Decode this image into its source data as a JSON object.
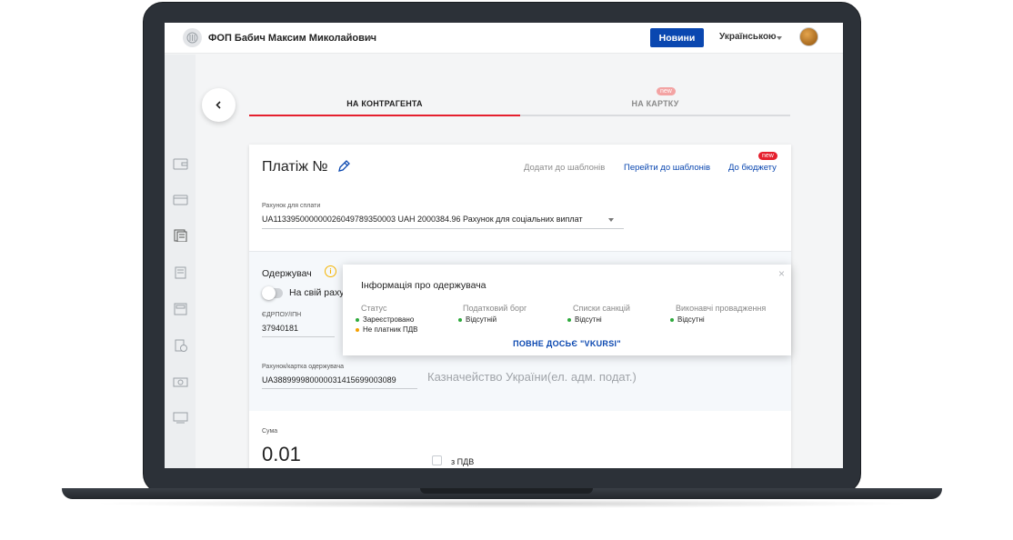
{
  "topbar": {
    "company_name": "ФОП Бабич Максим Миколайович",
    "news_button": "Новини",
    "language": "Українською"
  },
  "tabs": [
    {
      "label": "НА КОНТРАГЕНТА",
      "active": true
    },
    {
      "label": "НА КАРТКУ",
      "badge": "new",
      "active": false
    }
  ],
  "payment": {
    "title": "Платіж №",
    "add_to_templates": "Додати до шаблонів",
    "go_to_templates": "Перейти до шаблонів",
    "to_budget": "До бюджету",
    "to_budget_badge": "new",
    "account_label": "Рахунок для сплати",
    "account_value": "UA113395000000026049789350003 UAH 2000384.96 Рахунок для соціальних виплат"
  },
  "recipient": {
    "title": "Одержувач",
    "own_account_label": "На свій рахун",
    "edrpou_label": "ЄДРПОУ/ІПН",
    "edrpou_value": "37940181",
    "account_label": "Рахунок/картка одержувача",
    "account_value": "UA388999980000031415699003089",
    "name": "Казначейство України(ел. адм. подат.)"
  },
  "amount": {
    "label": "Сума",
    "value": "0.01",
    "vat_label": "з ПДВ"
  },
  "popup": {
    "title": "Інформація про одержувача",
    "close": "×",
    "columns": [
      {
        "title": "Статус",
        "items": [
          {
            "text": "Зареєстровано",
            "color": "#2eaa3c"
          },
          {
            "text": "Не платник ПДВ",
            "color": "#f5a000"
          }
        ]
      },
      {
        "title": "Податковий борг",
        "items": [
          {
            "text": "Відсутній",
            "color": "#2eaa3c"
          }
        ]
      },
      {
        "title": "Списки санкцій",
        "items": [
          {
            "text": "Відсутні",
            "color": "#2eaa3c"
          }
        ]
      },
      {
        "title": "Виконавчі провадження",
        "items": [
          {
            "text": "Відсутні",
            "color": "#2eaa3c"
          }
        ]
      }
    ],
    "dossier_link": "ПОВНЕ ДОСЬЄ \"VKURSI\""
  },
  "colors": {
    "primary": "#0a47b0",
    "accent_red": "#e5202e",
    "warning": "#f5b400"
  },
  "rail_icons": [
    "wallet-icon",
    "card-icon",
    "documents-icon",
    "statement-icon",
    "calculator-icon",
    "invoice-icon",
    "cash-icon",
    "terminal-icon"
  ]
}
